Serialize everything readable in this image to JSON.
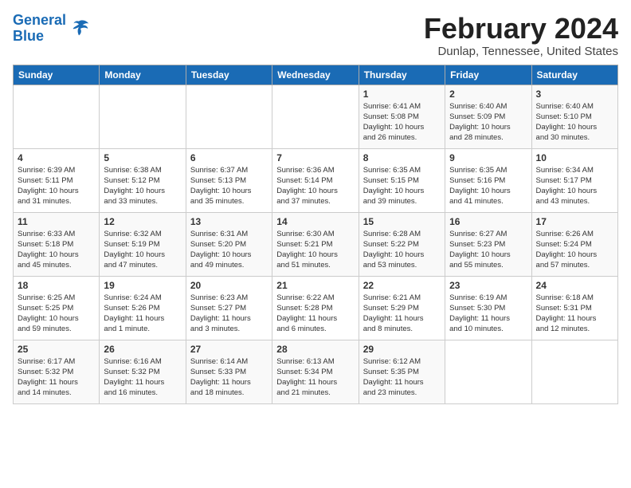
{
  "logo": {
    "line1": "General",
    "line2": "Blue"
  },
  "title": "February 2024",
  "subtitle": "Dunlap, Tennessee, United States",
  "days_of_week": [
    "Sunday",
    "Monday",
    "Tuesday",
    "Wednesday",
    "Thursday",
    "Friday",
    "Saturday"
  ],
  "weeks": [
    [
      {
        "day": "",
        "info": ""
      },
      {
        "day": "",
        "info": ""
      },
      {
        "day": "",
        "info": ""
      },
      {
        "day": "",
        "info": ""
      },
      {
        "day": "1",
        "info": "Sunrise: 6:41 AM\nSunset: 5:08 PM\nDaylight: 10 hours\nand 26 minutes."
      },
      {
        "day": "2",
        "info": "Sunrise: 6:40 AM\nSunset: 5:09 PM\nDaylight: 10 hours\nand 28 minutes."
      },
      {
        "day": "3",
        "info": "Sunrise: 6:40 AM\nSunset: 5:10 PM\nDaylight: 10 hours\nand 30 minutes."
      }
    ],
    [
      {
        "day": "4",
        "info": "Sunrise: 6:39 AM\nSunset: 5:11 PM\nDaylight: 10 hours\nand 31 minutes."
      },
      {
        "day": "5",
        "info": "Sunrise: 6:38 AM\nSunset: 5:12 PM\nDaylight: 10 hours\nand 33 minutes."
      },
      {
        "day": "6",
        "info": "Sunrise: 6:37 AM\nSunset: 5:13 PM\nDaylight: 10 hours\nand 35 minutes."
      },
      {
        "day": "7",
        "info": "Sunrise: 6:36 AM\nSunset: 5:14 PM\nDaylight: 10 hours\nand 37 minutes."
      },
      {
        "day": "8",
        "info": "Sunrise: 6:35 AM\nSunset: 5:15 PM\nDaylight: 10 hours\nand 39 minutes."
      },
      {
        "day": "9",
        "info": "Sunrise: 6:35 AM\nSunset: 5:16 PM\nDaylight: 10 hours\nand 41 minutes."
      },
      {
        "day": "10",
        "info": "Sunrise: 6:34 AM\nSunset: 5:17 PM\nDaylight: 10 hours\nand 43 minutes."
      }
    ],
    [
      {
        "day": "11",
        "info": "Sunrise: 6:33 AM\nSunset: 5:18 PM\nDaylight: 10 hours\nand 45 minutes."
      },
      {
        "day": "12",
        "info": "Sunrise: 6:32 AM\nSunset: 5:19 PM\nDaylight: 10 hours\nand 47 minutes."
      },
      {
        "day": "13",
        "info": "Sunrise: 6:31 AM\nSunset: 5:20 PM\nDaylight: 10 hours\nand 49 minutes."
      },
      {
        "day": "14",
        "info": "Sunrise: 6:30 AM\nSunset: 5:21 PM\nDaylight: 10 hours\nand 51 minutes."
      },
      {
        "day": "15",
        "info": "Sunrise: 6:28 AM\nSunset: 5:22 PM\nDaylight: 10 hours\nand 53 minutes."
      },
      {
        "day": "16",
        "info": "Sunrise: 6:27 AM\nSunset: 5:23 PM\nDaylight: 10 hours\nand 55 minutes."
      },
      {
        "day": "17",
        "info": "Sunrise: 6:26 AM\nSunset: 5:24 PM\nDaylight: 10 hours\nand 57 minutes."
      }
    ],
    [
      {
        "day": "18",
        "info": "Sunrise: 6:25 AM\nSunset: 5:25 PM\nDaylight: 10 hours\nand 59 minutes."
      },
      {
        "day": "19",
        "info": "Sunrise: 6:24 AM\nSunset: 5:26 PM\nDaylight: 11 hours\nand 1 minute."
      },
      {
        "day": "20",
        "info": "Sunrise: 6:23 AM\nSunset: 5:27 PM\nDaylight: 11 hours\nand 3 minutes."
      },
      {
        "day": "21",
        "info": "Sunrise: 6:22 AM\nSunset: 5:28 PM\nDaylight: 11 hours\nand 6 minutes."
      },
      {
        "day": "22",
        "info": "Sunrise: 6:21 AM\nSunset: 5:29 PM\nDaylight: 11 hours\nand 8 minutes."
      },
      {
        "day": "23",
        "info": "Sunrise: 6:19 AM\nSunset: 5:30 PM\nDaylight: 11 hours\nand 10 minutes."
      },
      {
        "day": "24",
        "info": "Sunrise: 6:18 AM\nSunset: 5:31 PM\nDaylight: 11 hours\nand 12 minutes."
      }
    ],
    [
      {
        "day": "25",
        "info": "Sunrise: 6:17 AM\nSunset: 5:32 PM\nDaylight: 11 hours\nand 14 minutes."
      },
      {
        "day": "26",
        "info": "Sunrise: 6:16 AM\nSunset: 5:32 PM\nDaylight: 11 hours\nand 16 minutes."
      },
      {
        "day": "27",
        "info": "Sunrise: 6:14 AM\nSunset: 5:33 PM\nDaylight: 11 hours\nand 18 minutes."
      },
      {
        "day": "28",
        "info": "Sunrise: 6:13 AM\nSunset: 5:34 PM\nDaylight: 11 hours\nand 21 minutes."
      },
      {
        "day": "29",
        "info": "Sunrise: 6:12 AM\nSunset: 5:35 PM\nDaylight: 11 hours\nand 23 minutes."
      },
      {
        "day": "",
        "info": ""
      },
      {
        "day": "",
        "info": ""
      }
    ]
  ]
}
